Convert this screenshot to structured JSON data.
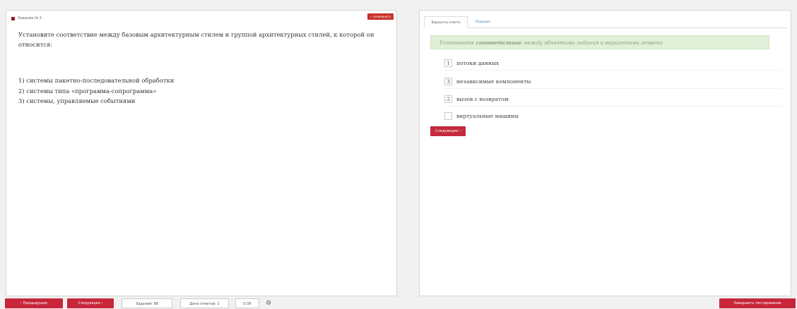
{
  "task": {
    "title": "Задание № 2",
    "fold_label": "— развернуть"
  },
  "question": {
    "text": "Установите соответствие между базовым архитектурным стилем и группой архитектурных стилей, к которой он относится:",
    "items": [
      "1) системы пакетно-последовательной обработки",
      "2) системы типа «программа-сопрограмма»",
      "3) системы, управляемые событиями"
    ]
  },
  "tabs": {
    "answers": "Варианты ответа",
    "solution": "Решение"
  },
  "hint": {
    "prefix": "Установите",
    "bold": "соответствие",
    "suffix": "между объектами задания и вариантами ответа"
  },
  "options": [
    {
      "num": "1",
      "label": "потоки данных"
    },
    {
      "num": "3",
      "label": "независимые компоненты"
    },
    {
      "num": "2",
      "label": "вызов с возвратом"
    },
    {
      "num": "",
      "label": "виртуальные машины"
    }
  ],
  "right_next_label": "Следующее ›",
  "bottom": {
    "prev_label": "‹ Предыдущее",
    "next_label": "Следующее ›",
    "tasks_label": "Заданий: 88",
    "answered_label": "Дано ответов: 1",
    "time": "0:39",
    "gear_icon": "⚙",
    "finish_label": "Завершить тестирование"
  },
  "colors": {
    "accent": "#c7263a",
    "hint_bg": "#dff0d8",
    "link": "#2d7fc1"
  }
}
